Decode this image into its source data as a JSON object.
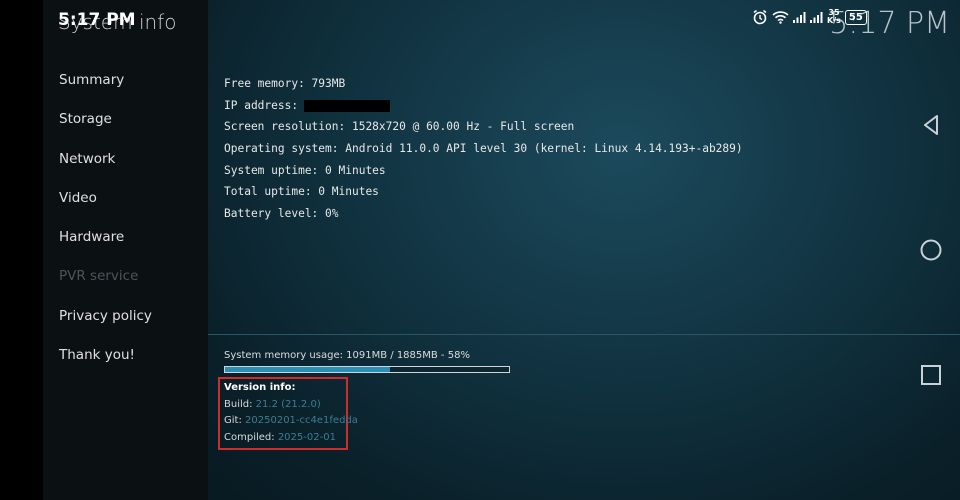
{
  "app": {
    "title": "System info"
  },
  "status_bar": {
    "time": "5:17 PM",
    "net_speed_value": "35",
    "net_speed_unit": "K/s",
    "battery": "55"
  },
  "clock": "5:17 PM",
  "sidebar": {
    "items": [
      {
        "label": "Summary",
        "enabled": true
      },
      {
        "label": "Storage",
        "enabled": true
      },
      {
        "label": "Network",
        "enabled": true
      },
      {
        "label": "Video",
        "enabled": true
      },
      {
        "label": "Hardware",
        "enabled": true
      },
      {
        "label": "PVR service",
        "enabled": false
      },
      {
        "label": "Privacy policy",
        "enabled": true
      },
      {
        "label": "Thank you!",
        "enabled": true
      }
    ]
  },
  "info": {
    "free_memory": "Free memory: 793MB",
    "ip_address_label": "IP address:",
    "screen_resolution": "Screen resolution: 1528x720 @ 60.00 Hz - Full screen",
    "operating_system": "Operating system: Android 11.0.0 API level 30 (kernel: Linux 4.14.193+-ab289)",
    "system_uptime": "System uptime: 0 Minutes",
    "total_uptime": "Total uptime: 0 Minutes",
    "battery_level": "Battery level: 0%"
  },
  "memory": {
    "usage_text": "System memory usage: 1091MB / 1885MB - 58%",
    "percent": 58
  },
  "version": {
    "heading": "Version info:",
    "build_label": "Build:",
    "build_value": "21.2 (21.2.0)",
    "git_label": "Git:",
    "git_value": "20250201-cc4e1fedda",
    "compiled_label": "Compiled:",
    "compiled_value": "2025-02-01"
  },
  "colors": {
    "highlight": "#d22b2b",
    "accent": "#2a8fb5",
    "version_value": "#3b7d96"
  },
  "nav_buttons": [
    "back-icon",
    "home-icon",
    "recents-icon"
  ]
}
